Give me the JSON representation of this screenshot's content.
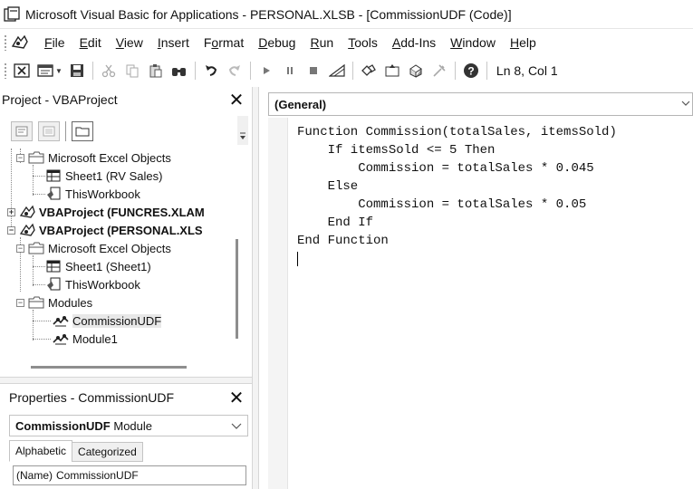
{
  "window": {
    "title": "Microsoft Visual Basic for Applications - PERSONAL.XLSB - [CommissionUDF (Code)]",
    "icon": "vba-app-icon"
  },
  "menu": {
    "icon": "vba-menu-icon",
    "items": [
      {
        "label": "File",
        "accel": "F"
      },
      {
        "label": "Edit",
        "accel": "E"
      },
      {
        "label": "View",
        "accel": "V"
      },
      {
        "label": "Insert",
        "accel": "I"
      },
      {
        "label": "Format",
        "accel": "o"
      },
      {
        "label": "Debug",
        "accel": "D"
      },
      {
        "label": "Run",
        "accel": "R"
      },
      {
        "label": "Tools",
        "accel": "T"
      },
      {
        "label": "Add-Ins",
        "accel": "A"
      },
      {
        "label": "Window",
        "accel": "W"
      },
      {
        "label": "Help",
        "accel": "H"
      }
    ]
  },
  "toolbar": {
    "status_position": "Ln 8, Col 1",
    "buttons": [
      "view-excel-icon",
      "insert-module-icon",
      "save-icon",
      "cut-icon",
      "copy-icon",
      "paste-icon",
      "find-icon",
      "undo-icon",
      "redo-icon",
      "run-icon",
      "break-icon",
      "reset-icon",
      "design-mode-icon",
      "project-explorer-icon",
      "properties-icon",
      "object-browser-icon",
      "toolbox-icon",
      "help-icon"
    ]
  },
  "project": {
    "header": "Project - VBAProject",
    "tree": [
      {
        "label": "Microsoft Excel Objects",
        "type": "folder",
        "expanded": true
      },
      {
        "label": "Sheet1 (RV Sales)",
        "type": "sheet"
      },
      {
        "label": "ThisWorkbook",
        "type": "workbook"
      },
      {
        "label": "VBAProject (FUNCRES.XLAM",
        "type": "project",
        "expanded": false
      },
      {
        "label": "VBAProject (PERSONAL.XLS",
        "type": "project",
        "expanded": true
      },
      {
        "label": "Microsoft Excel Objects",
        "type": "folder",
        "expanded": true
      },
      {
        "label": "Sheet1 (Sheet1)",
        "type": "sheet"
      },
      {
        "label": "ThisWorkbook",
        "type": "workbook"
      },
      {
        "label": "Modules",
        "type": "folder",
        "expanded": true
      },
      {
        "label": "CommissionUDF",
        "type": "module",
        "selected": true
      },
      {
        "label": "Module1",
        "type": "module"
      }
    ]
  },
  "properties": {
    "header": "Properties - CommissionUDF",
    "object_name": "CommissionUDF",
    "object_type": "Module",
    "tabs": [
      "Alphabetic",
      "Categorized"
    ],
    "active_tab": "Alphabetic",
    "rows": [
      {
        "name": "(Name)",
        "value": "CommissionUDF"
      }
    ]
  },
  "code": {
    "object_combo": "(General)",
    "lines": [
      "Function Commission(totalSales, itemsSold)",
      "    If itemsSold <= 5 Then",
      "        Commission = totalSales * 0.045",
      "    Else",
      "        Commission = totalSales * 0.05",
      "    End If",
      "End Function",
      ""
    ]
  }
}
